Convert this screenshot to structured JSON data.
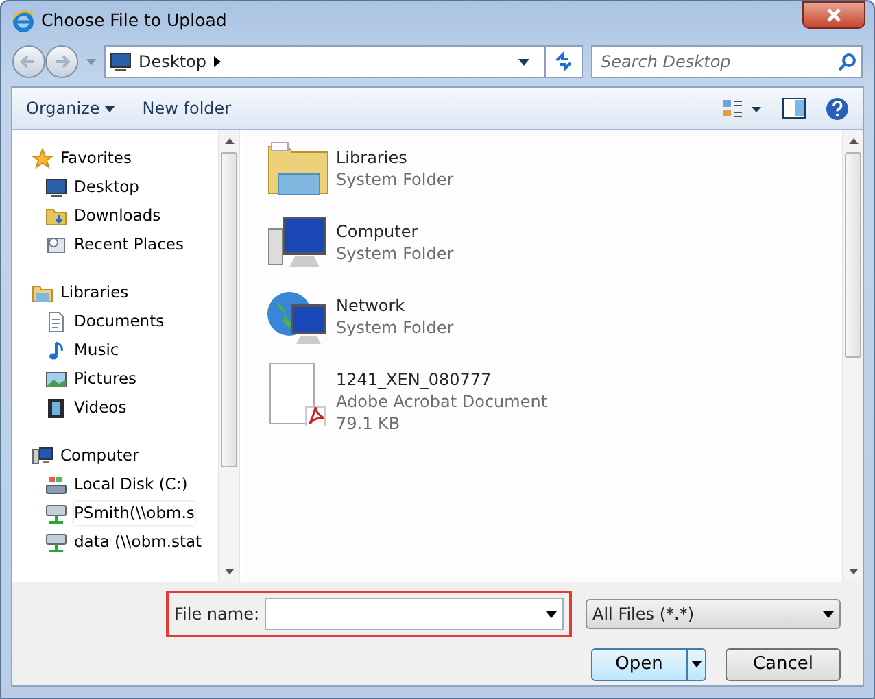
{
  "window": {
    "title": "Choose File to Upload"
  },
  "address": {
    "location": "Desktop"
  },
  "search": {
    "placeholder": "Search Desktop"
  },
  "toolbar": {
    "organize": "Organize",
    "new_folder": "New folder"
  },
  "sidebar": [
    {
      "label": "Favorites",
      "kind": "star",
      "children": [
        {
          "label": "Desktop",
          "kind": "desktop"
        },
        {
          "label": "Downloads",
          "kind": "downloads"
        },
        {
          "label": "Recent Places",
          "kind": "recent"
        }
      ]
    },
    {
      "label": "Libraries",
      "kind": "library",
      "children": [
        {
          "label": "Documents",
          "kind": "document"
        },
        {
          "label": "Music",
          "kind": "music"
        },
        {
          "label": "Pictures",
          "kind": "picture"
        },
        {
          "label": "Videos",
          "kind": "video"
        }
      ]
    },
    {
      "label": "Computer",
      "kind": "computer",
      "children": [
        {
          "label": "Local Disk (C:)",
          "kind": "disk"
        },
        {
          "label": "PSmith(\\\\obm.s",
          "kind": "netdrive"
        },
        {
          "label": "data (\\\\obm.stat",
          "kind": "netdrive"
        }
      ]
    }
  ],
  "files": [
    {
      "name": "Libraries",
      "kind": "library",
      "details": [
        "System Folder"
      ]
    },
    {
      "name": "Computer",
      "kind": "computer",
      "details": [
        "System Folder"
      ]
    },
    {
      "name": "Network",
      "kind": "network",
      "details": [
        "System Folder"
      ]
    },
    {
      "name": "1241_XEN_080777",
      "kind": "pdf",
      "details": [
        "Adobe Acrobat Document",
        "79.1 KB"
      ]
    }
  ],
  "footer": {
    "file_name_label": "File name:",
    "highlighted": true,
    "file_type": "All Files (*.*)",
    "buttons": [
      "Open",
      "Cancel"
    ]
  }
}
